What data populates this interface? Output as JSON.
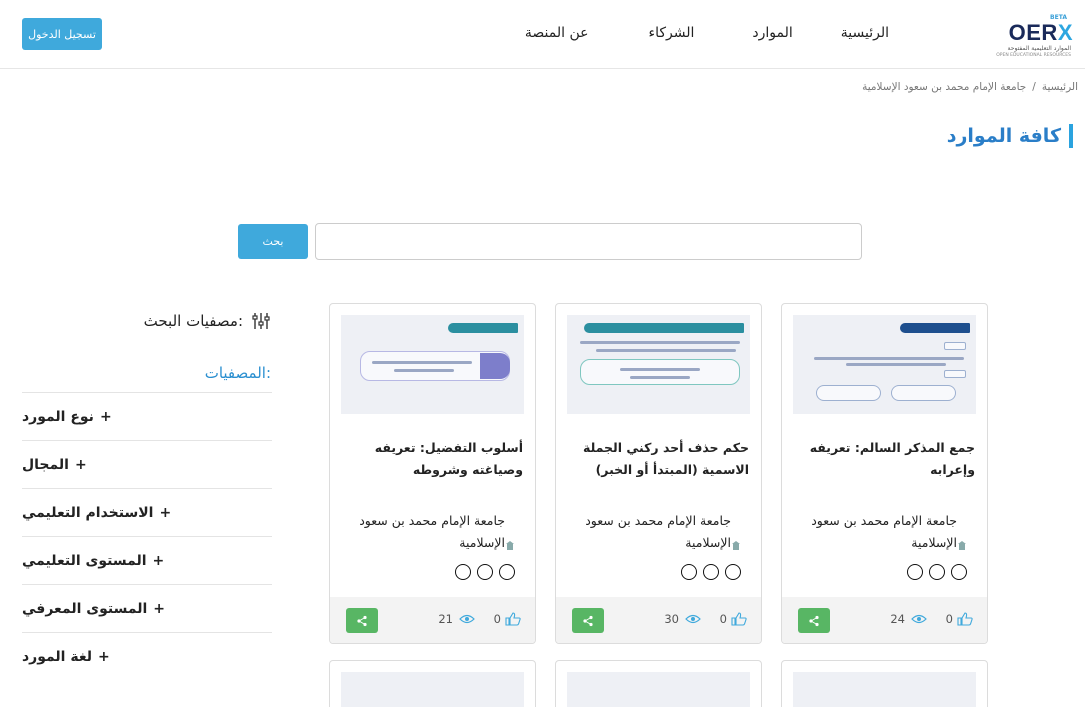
{
  "header": {
    "logo": {
      "beta": "BETA",
      "word": "OER",
      "x": "X",
      "sub1": "الموارد التعليمية المفتوحة",
      "sub2": "OPEN EDUCATIONAL RESOURCES"
    },
    "nav": [
      {
        "label": "الرئيسية"
      },
      {
        "label": "الموارد"
      },
      {
        "label": "الشركاء"
      },
      {
        "label": "عن المنصة"
      }
    ],
    "login_label": "تسجيل الدخول"
  },
  "breadcrumb": {
    "home": "الرئيسية",
    "separator": "/",
    "current": "جامعة الإمام محمد بن سعود الإسلامية"
  },
  "page_title": "كافة الموارد",
  "search": {
    "placeholder": "",
    "button_label": "بحث"
  },
  "sidebar": {
    "filter_title": "مصفيات البحث:",
    "filters_label": "المصفيات:",
    "items": [
      {
        "label": "نوع المورد"
      },
      {
        "label": "المجال"
      },
      {
        "label": "الاستخدام التعليمي"
      },
      {
        "label": "المستوى التعليمي"
      },
      {
        "label": "المستوى المعرفي"
      },
      {
        "label": "لغة المورد"
      }
    ]
  },
  "cards": [
    {
      "title": "جمع المذكر السالم: تعريفه وإعرابه",
      "org": "جامعة الإمام محمد بن سعود الإسلامية",
      "likes": "0",
      "views": "24",
      "thumb_banner": "جمع المذكر السالم",
      "accent": "#1e4f8e"
    },
    {
      "title": "حكم حذف أحد ركني الجملة الاسمية (المبتدأ أو الخبر)",
      "org": "جامعة الإمام محمد بن سعود الإسلامية",
      "likes": "0",
      "views": "30",
      "thumb_banner": "حكم حذف أحد ركني الجملة الاسمية (المبتدأ أو الخبر)",
      "accent": "#2b8fa0"
    },
    {
      "title": "أسلوب التفضيل: تعريفه وصياغته وشروطه",
      "org": "جامعة الإمام محمد بن سعود الإسلامية",
      "likes": "0",
      "views": "21",
      "thumb_banner": "أسلوب التفضيل",
      "accent": "#7d7ecb"
    }
  ],
  "colors": {
    "primary": "#3fa9dc",
    "title_blue": "#2a7ec8",
    "share_green": "#58b664"
  }
}
